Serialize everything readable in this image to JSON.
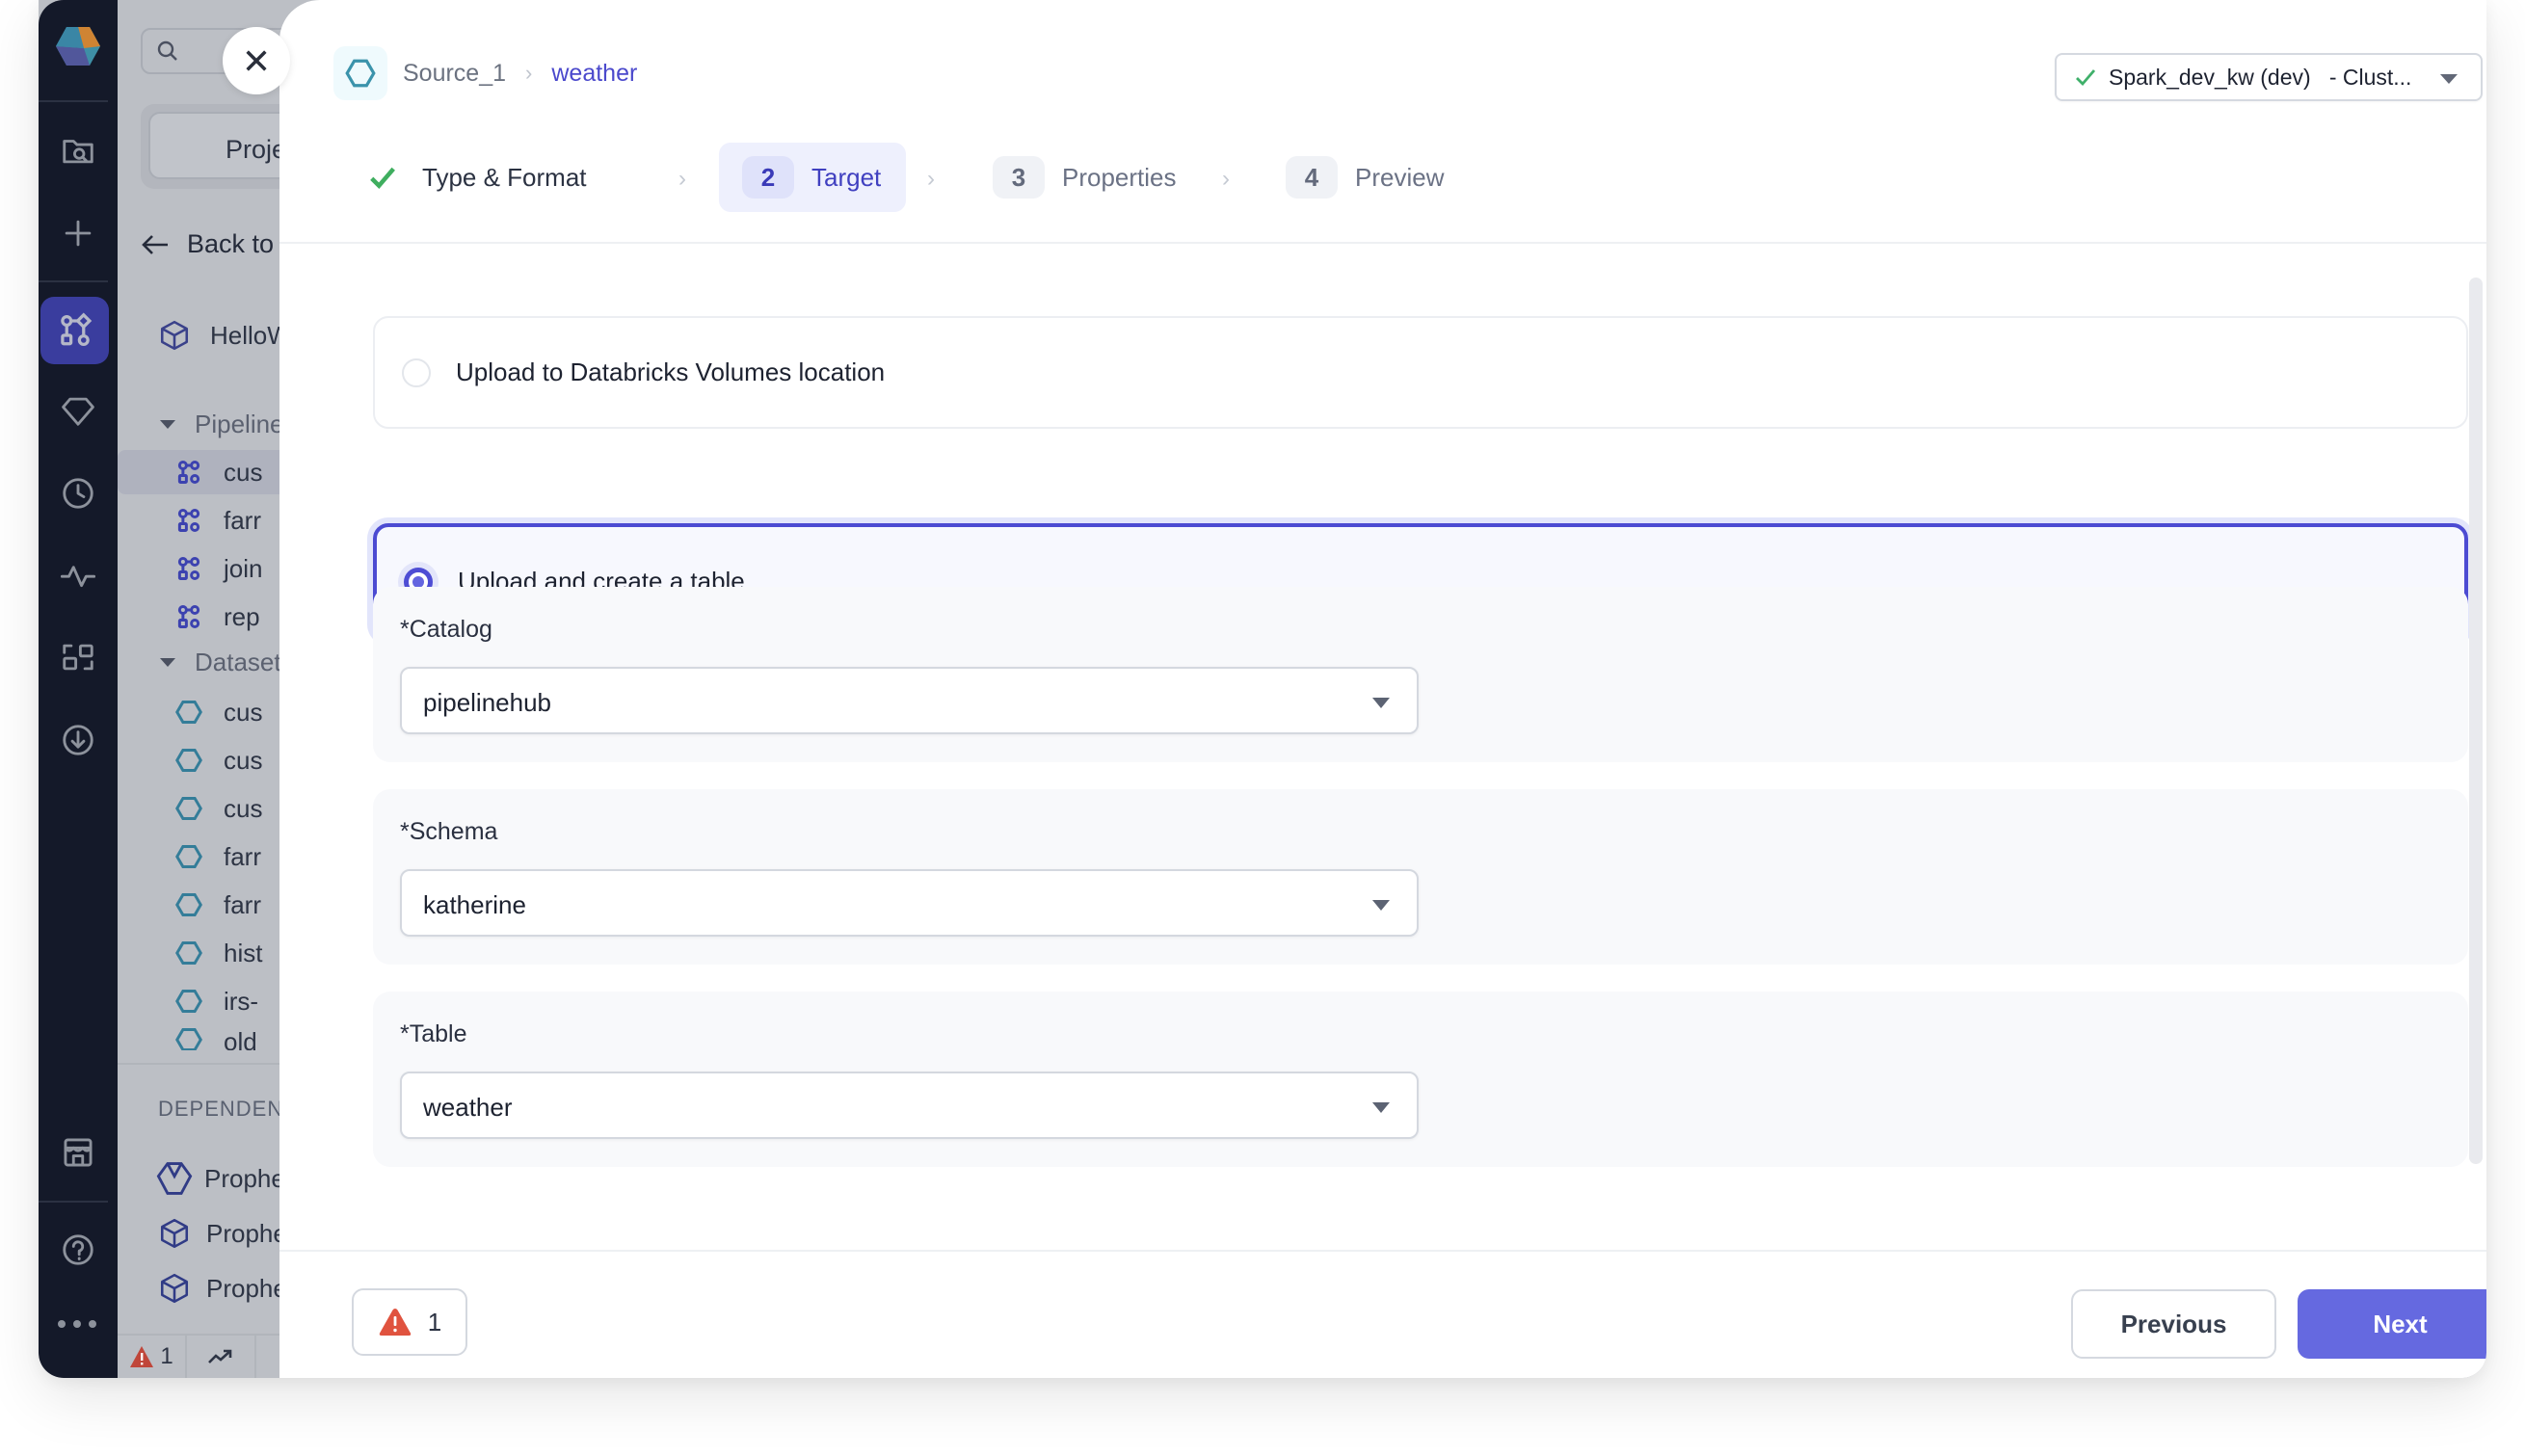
{
  "nav_rail": {
    "items": [
      {
        "icon": "folder-search-icon"
      },
      {
        "icon": "plus-icon"
      },
      {
        "icon": "pipeline-icon",
        "active": true
      },
      {
        "icon": "gem-icon"
      },
      {
        "icon": "clock-icon"
      },
      {
        "icon": "activity-icon"
      },
      {
        "icon": "lineage-icon"
      },
      {
        "icon": "download-icon"
      },
      {
        "icon": "marketplace-icon"
      },
      {
        "icon": "help-icon"
      },
      {
        "icon": "more-icon"
      }
    ]
  },
  "project_panel": {
    "search_placeholder": "Search",
    "project_button": "Project",
    "back_label": "Back to",
    "project_name": "HelloW",
    "pipelines_section": "Pipelines",
    "pipelines": [
      "cus",
      "farr",
      "join",
      "rep"
    ],
    "datasets_section": "Datasets",
    "datasets": [
      "cus",
      "cus",
      "cus",
      "farr",
      "farr",
      "hist",
      "irs-",
      "old"
    ],
    "dependencies_section": "DEPENDENC",
    "dependencies": [
      "Prophe",
      "Prophe",
      "Prophe"
    ],
    "status": {
      "errors": "1"
    }
  },
  "modal": {
    "breadcrumb": {
      "source": "Source_1",
      "separator": "›",
      "current": "weather"
    },
    "cluster": {
      "label": "Spark_dev_kw (dev)   - Clust...",
      "status": "connected"
    },
    "steps": [
      {
        "number": "1",
        "label": "Type & Format",
        "state": "done"
      },
      {
        "number": "2",
        "label": "Target",
        "state": "active"
      },
      {
        "number": "3",
        "label": "Properties",
        "state": "pending"
      },
      {
        "number": "4",
        "label": "Preview",
        "state": "pending"
      }
    ],
    "step_separator": "›",
    "options": [
      {
        "label": "Upload to Databricks Volumes location",
        "selected": false
      },
      {
        "label": "Upload and create a table",
        "selected": true
      }
    ],
    "fields": [
      {
        "label": "*Catalog",
        "value": "pipelinehub"
      },
      {
        "label": "*Schema",
        "value": "katherine"
      },
      {
        "label": "*Table",
        "value": "weather"
      }
    ],
    "footer": {
      "error_count": "1",
      "previous_label": "Previous",
      "next_label": "Next"
    }
  },
  "colors": {
    "accent": "#6569e0",
    "accent_dark": "#4c4bd2",
    "success": "#3fae5f",
    "error": "#e0533f",
    "rail_bg": "#141929"
  }
}
